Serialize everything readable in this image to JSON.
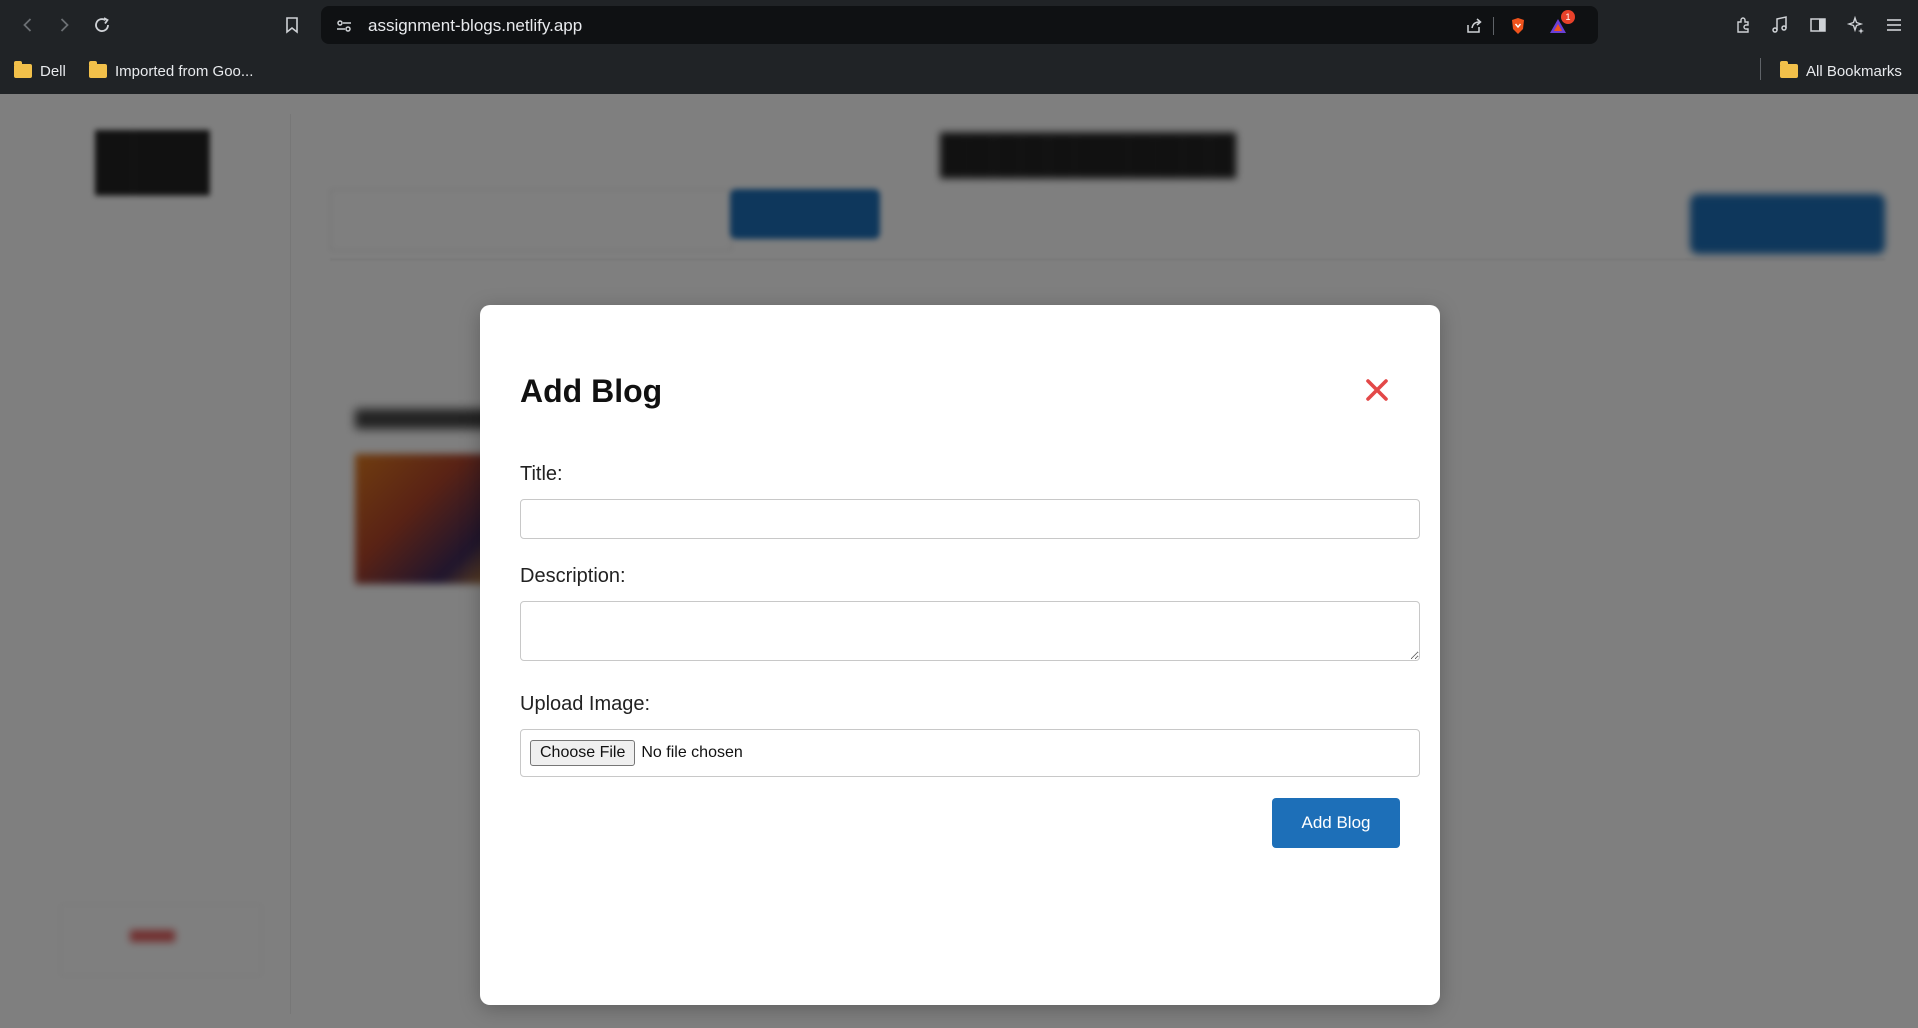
{
  "browser": {
    "url": "assignment-blogs.netlify.app",
    "notification_count": "1",
    "bookmarks": [
      {
        "label": "Dell"
      },
      {
        "label": "Imported from Goo..."
      }
    ],
    "all_bookmarks_label": "All Bookmarks"
  },
  "modal": {
    "title": "Add Blog",
    "title_label": "Title:",
    "title_value": "",
    "description_label": "Description:",
    "description_value": "",
    "image_label": "Upload Image:",
    "choose_file_label": "Choose File",
    "file_status": "No file chosen",
    "submit_label": "Add Blog"
  },
  "colors": {
    "accent": "#1d6fb8",
    "close": "#e34848",
    "chrome_bg": "#202326"
  }
}
